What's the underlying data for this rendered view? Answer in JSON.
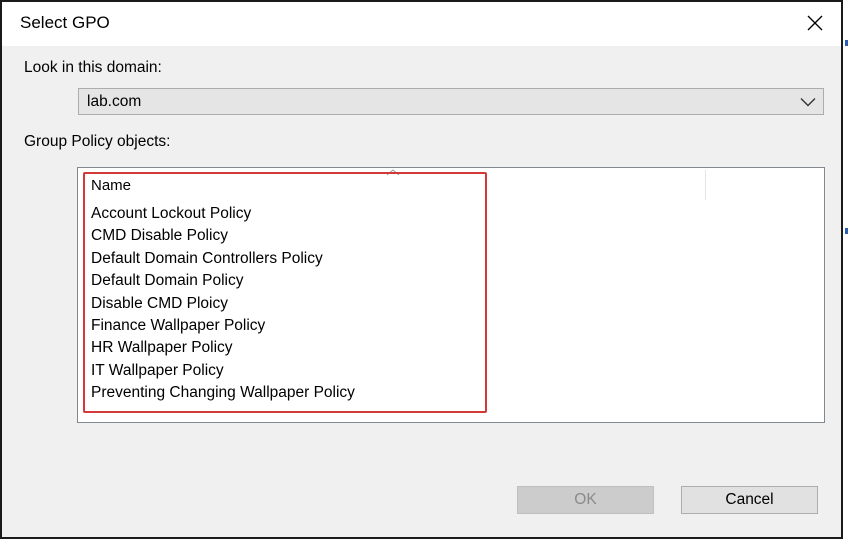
{
  "window": {
    "title": "Select GPO",
    "close_glyph": "✕"
  },
  "domain": {
    "label": "Look in this domain:",
    "selected": "lab.com"
  },
  "gpo_list": {
    "label": "Group Policy objects:",
    "column_header": "Name",
    "items": [
      "Account Lockout Policy",
      "CMD Disable Policy",
      "Default Domain Controllers Policy",
      "Default Domain Policy",
      "Disable CMD Ploicy",
      "Finance Wallpaper Policy",
      "HR Wallpaper Policy",
      "IT Wallpaper Policy",
      "Preventing Changing Wallpaper Policy"
    ]
  },
  "buttons": {
    "ok_label": "OK",
    "ok_enabled": false,
    "cancel_label": "Cancel"
  },
  "icons": {
    "close": "close-icon",
    "dropdown": "chevron-down-icon",
    "sort": "sort-ascending-icon"
  },
  "colors": {
    "highlight_border": "#d23a3a",
    "dialog_bg": "#f0f0f0"
  }
}
